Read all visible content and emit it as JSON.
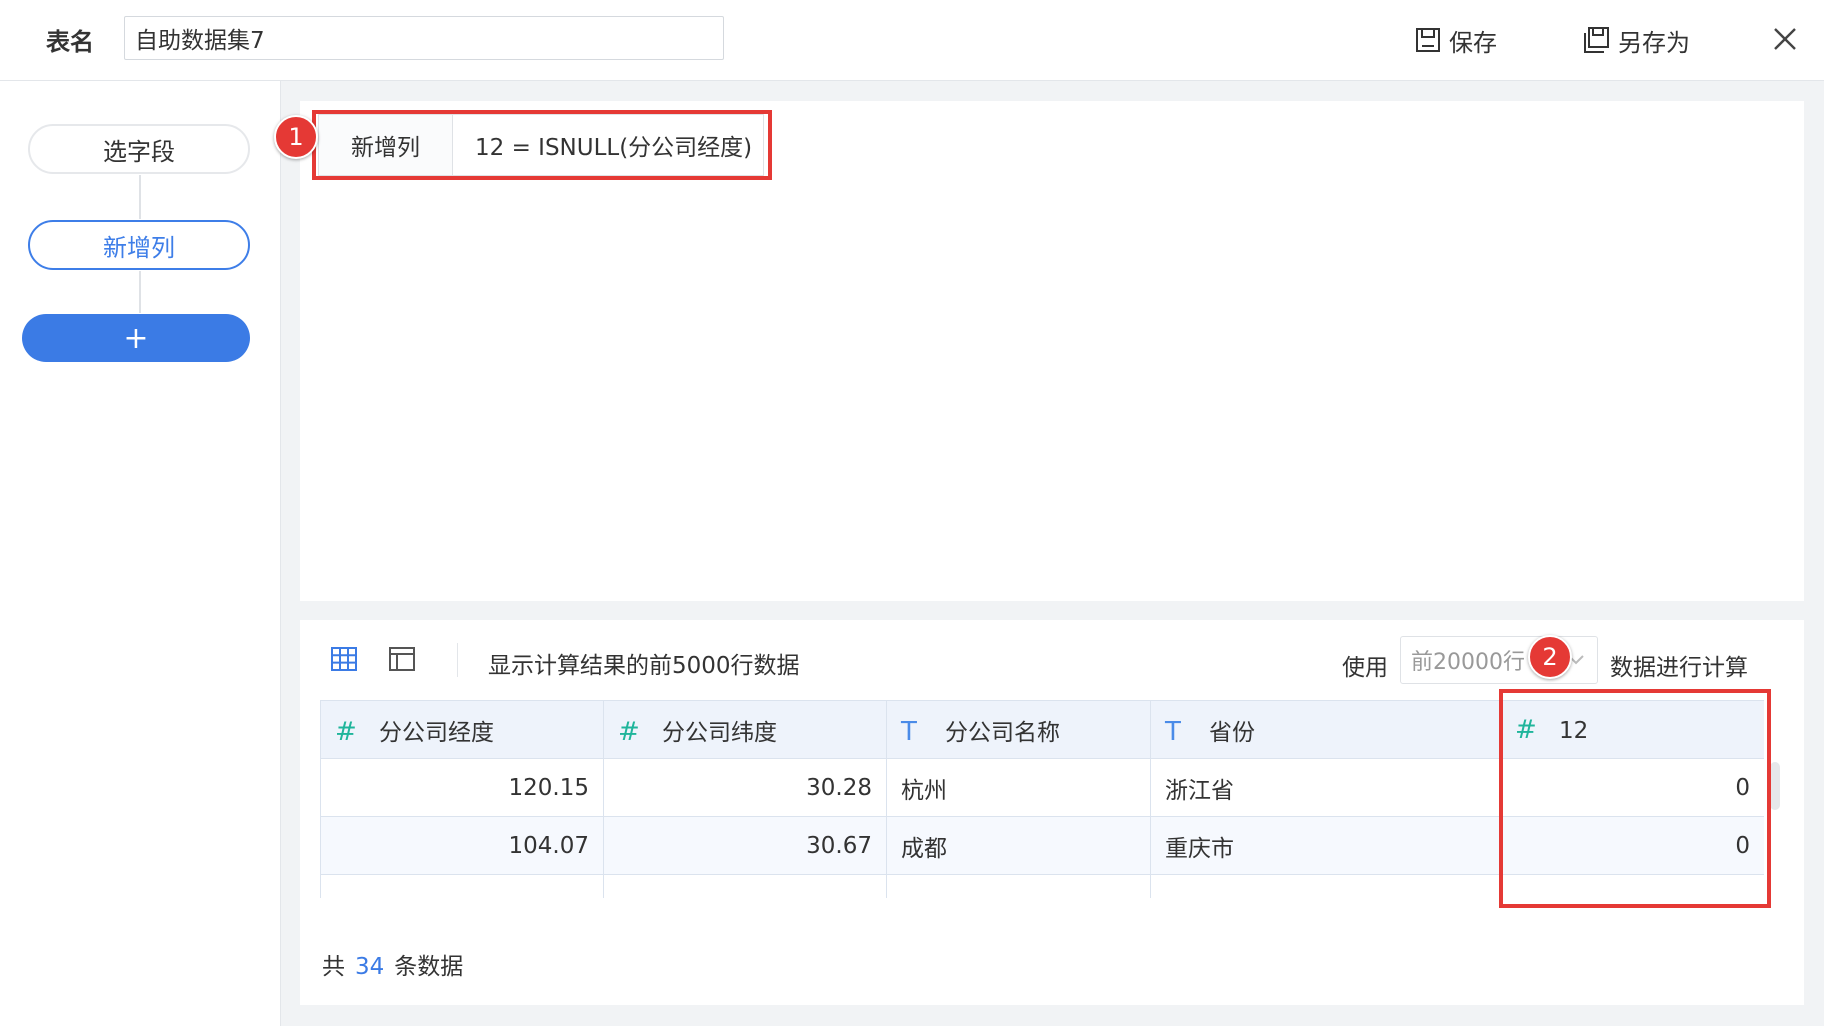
{
  "header": {
    "table_name_label": "表名",
    "table_name_value": "自助数据集7",
    "save_label": "保存",
    "save_as_label": "另存为"
  },
  "steps": {
    "items": [
      {
        "label": "选字段",
        "state": "normal"
      },
      {
        "label": "新增列",
        "state": "active"
      }
    ],
    "add_label": "+"
  },
  "formula": {
    "label": "新增列",
    "expression": "12 = ISNULL(分公司经度)"
  },
  "preview": {
    "note": "显示计算结果的前5000行数据",
    "use_label": "使用",
    "row_limit_selected": "前20000行",
    "calc_label": "数据进行计算",
    "columns": [
      {
        "type_icon": "#",
        "type": "number",
        "name": "分公司经度"
      },
      {
        "type_icon": "#",
        "type": "number",
        "name": "分公司纬度"
      },
      {
        "type_icon": "T",
        "type": "text",
        "name": "分公司名称"
      },
      {
        "type_icon": "T",
        "type": "text",
        "name": "省份"
      },
      {
        "type_icon": "#",
        "type": "number",
        "name": "12"
      }
    ],
    "rows": [
      [
        "120.15",
        "30.28",
        "杭州",
        "浙江省",
        "0"
      ],
      [
        "104.07",
        "30.67",
        "成都",
        "重庆市",
        "0"
      ]
    ],
    "total_prefix": "共",
    "total_count": "34",
    "total_suffix": "条数据"
  },
  "annotations": {
    "badge_1": "1",
    "badge_2": "2",
    "color": "#e53935"
  },
  "colors": {
    "accent": "#3b7be5",
    "number_type": "#1fb59b",
    "text_type": "#4a8be8"
  }
}
